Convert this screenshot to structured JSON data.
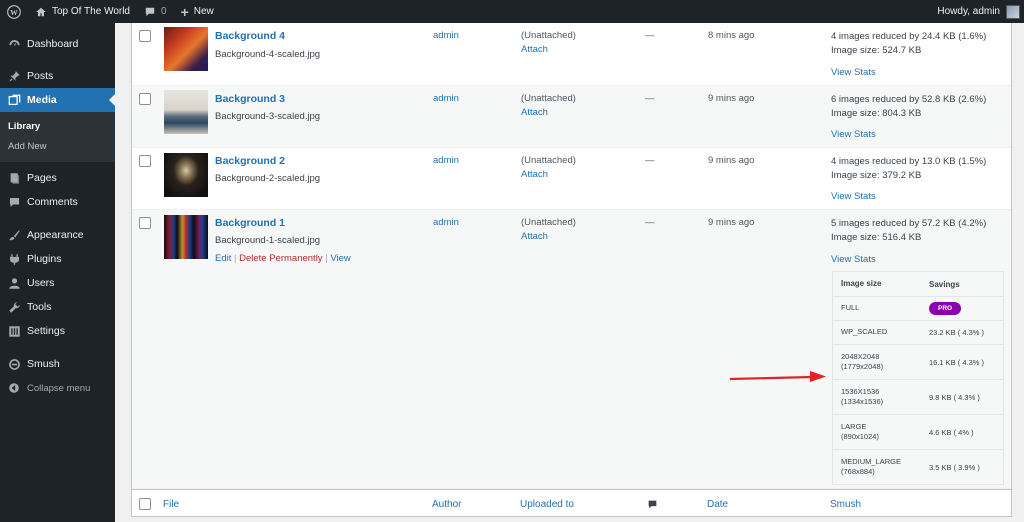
{
  "adminbar": {
    "site_name": "Top Of The World",
    "comments_count": "0",
    "new_label": "New",
    "howdy": "Howdy, admin"
  },
  "sidebar": {
    "items": [
      {
        "label": "Dashboard",
        "icon": "dashboard-icon"
      },
      {
        "label": "Posts",
        "icon": "pin-icon"
      },
      {
        "label": "Media",
        "icon": "media-icon"
      },
      {
        "label": "Pages",
        "icon": "page-icon"
      },
      {
        "label": "Comments",
        "icon": "comment-icon"
      },
      {
        "label": "Appearance",
        "icon": "brush-icon"
      },
      {
        "label": "Plugins",
        "icon": "plugin-icon"
      },
      {
        "label": "Users",
        "icon": "user-icon"
      },
      {
        "label": "Tools",
        "icon": "wrench-icon"
      },
      {
        "label": "Settings",
        "icon": "settings-icon"
      },
      {
        "label": "Smush",
        "icon": "smush-icon"
      }
    ],
    "submenu": [
      "Library",
      "Add New"
    ],
    "collapse_label": "Collapse menu"
  },
  "media_rows": [
    {
      "title": "Background 4",
      "file": "Background-4-scaled.jpg",
      "author": "admin",
      "uploaded": "(Unattached)",
      "attach": "Attach",
      "comments": "—",
      "date": "8 mins ago",
      "smush_line1": "4 images reduced by 24.4 KB (1.6%)",
      "smush_line2": "Image size: 524.7 KB",
      "view_stats": "View Stats"
    },
    {
      "title": "Background 3",
      "file": "Background-3-scaled.jpg",
      "author": "admin",
      "uploaded": "(Unattached)",
      "attach": "Attach",
      "comments": "—",
      "date": "9 mins ago",
      "smush_line1": "6 images reduced by 52.8 KB (2.6%)",
      "smush_line2": "Image size: 804.3 KB",
      "view_stats": "View Stats"
    },
    {
      "title": "Background 2",
      "file": "Background-2-scaled.jpg",
      "author": "admin",
      "uploaded": "(Unattached)",
      "attach": "Attach",
      "comments": "—",
      "date": "9 mins ago",
      "smush_line1": "4 images reduced by 13.0 KB (1.5%)",
      "smush_line2": "Image size: 379.2 KB",
      "view_stats": "View Stats"
    },
    {
      "title": "Background 1",
      "file": "Background-1-scaled.jpg",
      "author": "admin",
      "uploaded": "(Unattached)",
      "attach": "Attach",
      "comments": "—",
      "date": "9 mins ago",
      "smush_line1": "5 images reduced by 57.2 KB (4.2%)",
      "smush_line2": "Image size: 516.4 KB",
      "view_stats": "View Stats"
    }
  ],
  "row_actions": {
    "edit": "Edit",
    "delete": "Delete Permanently",
    "view": "View",
    "sep": "|"
  },
  "stats": {
    "header_size": "Image size",
    "header_savings": "Savings",
    "pro_badge": "PRO",
    "rows": [
      {
        "size": "FULL",
        "dims": "",
        "savings": ""
      },
      {
        "size": "WP_SCALED",
        "dims": "",
        "savings": "23.2 KB ( 4.3% )"
      },
      {
        "size": "2048X2048",
        "dims": "(1779x2048)",
        "savings": "16.1 KB ( 4.3% )"
      },
      {
        "size": "1536X1536",
        "dims": "(1334x1536)",
        "savings": "9.8 KB ( 4.3% )"
      },
      {
        "size": "LARGE",
        "dims": "(890x1024)",
        "savings": "4.6 KB ( 4% )"
      },
      {
        "size": "MEDIUM_LARGE",
        "dims": "(768x884)",
        "savings": "3.5 KB ( 3.9% )"
      }
    ]
  },
  "footer_columns": {
    "file": "File",
    "author": "Author",
    "uploaded": "Uploaded to",
    "date": "Date",
    "smush": "Smush"
  },
  "colors": {
    "accent": "#2271b1",
    "admin_bg": "#1d2327",
    "pro": "#8d00b1",
    "arrow": "#e02424"
  }
}
